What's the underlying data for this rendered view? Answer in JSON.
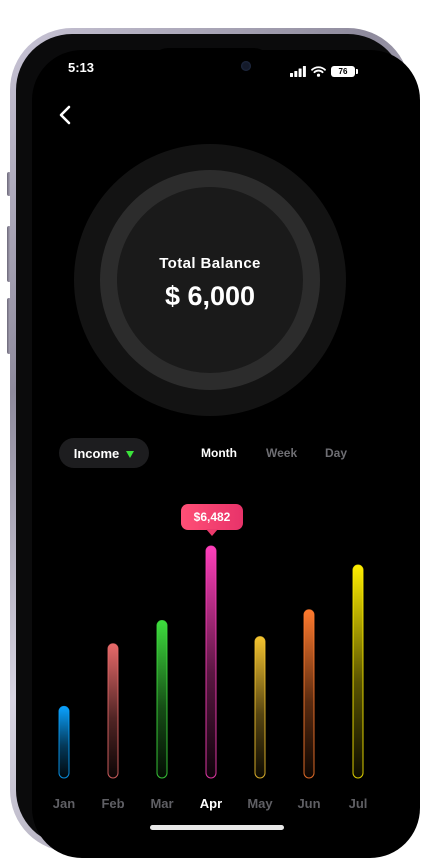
{
  "status_bar": {
    "time": "5:13",
    "battery": "76"
  },
  "balance": {
    "label": "Total Balance",
    "value": "$ 6,000"
  },
  "filter": {
    "label": "Income"
  },
  "tabs": [
    "Month",
    "Week",
    "Day"
  ],
  "active_tab": "Month",
  "tooltip": {
    "value": "$6,482"
  },
  "chart_data": {
    "type": "bar",
    "categories": [
      "Jan",
      "Feb",
      "Mar",
      "Apr",
      "May",
      "Jun",
      "Jul"
    ],
    "values": [
      2000,
      3750,
      4400,
      6482,
      3950,
      4700,
      5950
    ],
    "active_category": "Apr",
    "colors": [
      "#0aa2ff",
      "#e86a6a",
      "#3ede3e",
      "#ff3fbb",
      "#f4c430",
      "#ff7a2e",
      "#ffee00"
    ],
    "ylim": [
      0,
      7000
    ]
  }
}
